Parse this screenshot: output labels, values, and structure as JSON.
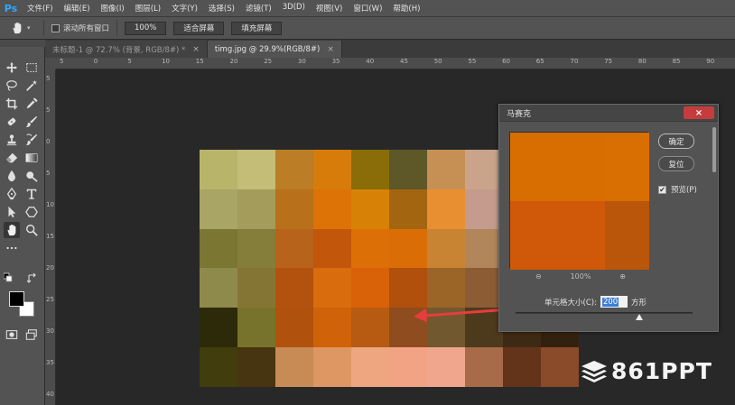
{
  "app": {
    "logo": "Ps"
  },
  "menu": [
    "文件(F)",
    "编辑(E)",
    "图像(I)",
    "图层(L)",
    "文字(Y)",
    "选择(S)",
    "滤镜(T)",
    "3D(D)",
    "视图(V)",
    "窗口(W)",
    "帮助(H)"
  ],
  "options": {
    "scroll_all_label": "滚动所有窗口",
    "zoom_value": "100%",
    "fit_screen": "适合屏幕",
    "fill_screen": "填充屏幕"
  },
  "tabs": [
    {
      "label": "未标题-1 @ 72.7% (背景, RGB/8#) *",
      "active": false
    },
    {
      "label": "timg.jpg @ 29.9%(RGB/8#)",
      "active": true
    }
  ],
  "ruler": {
    "top": [
      "5",
      "0",
      "5",
      "10",
      "15",
      "20",
      "25",
      "30",
      "35",
      "40",
      "45",
      "50",
      "55",
      "60",
      "65",
      "70",
      "75",
      "80",
      "85",
      "90"
    ],
    "left": [
      "5",
      "5",
      "0",
      "5",
      "10",
      "15",
      "20",
      "25",
      "30",
      "35",
      "40"
    ]
  },
  "mosaic_colors": [
    [
      "#b8b56a",
      "#c4bd78",
      "#bb7d25",
      "#d77c0b",
      "#8a6d08",
      "#5e5727",
      "#c69055",
      "#c9a48a",
      "#c79a7e",
      "#b58a6c"
    ],
    [
      "#a9a564",
      "#a39c5b",
      "#b8701a",
      "#dd7206",
      "#d88107",
      "#a46511",
      "#e88f31",
      "#c49b8c",
      "#ba8d78",
      "#a88169"
    ],
    [
      "#7b7631",
      "#857d3a",
      "#b8631c",
      "#c2560a",
      "#dd6f07",
      "#db6d07",
      "#c98433",
      "#b2865b",
      "#9d7355",
      "#8d6549"
    ],
    [
      "#8d8a4c",
      "#857534",
      "#b3520e",
      "#d96d0e",
      "#d96108",
      "#b14f0c",
      "#9c6528",
      "#8c5c35",
      "#7a4d2e",
      "#6b4226"
    ],
    [
      "#2c2a08",
      "#77732c",
      "#b0520e",
      "#d06209",
      "#b75b12",
      "#8e4c1f",
      "#72582e",
      "#4d3a1c",
      "#3e2a14",
      "#33210f"
    ],
    [
      "#413d0c",
      "#473410",
      "#c98b55",
      "#de9762",
      "#eda67f",
      "#f2a383",
      "#f0a68c",
      "#a86b4a",
      "#63341a",
      "#8a4b2b"
    ]
  ],
  "dialog": {
    "title": "马赛克",
    "close": "×",
    "ok": "确定",
    "reset": "复位",
    "preview_label": "预览(P)",
    "preview_checked": true,
    "preview_colors": [
      "#d86e02",
      "#d96e02",
      "#cf5908",
      "#b9560a"
    ],
    "zoom_out": "⊖",
    "zoom_in": "⊕",
    "zoom_value": "100%",
    "cell_size_label": "单元格大小(C):",
    "cell_size_value": "200",
    "cell_size_unit": "方形",
    "slider_fraction": 0.7
  },
  "watermark": {
    "text": "861PPT"
  }
}
